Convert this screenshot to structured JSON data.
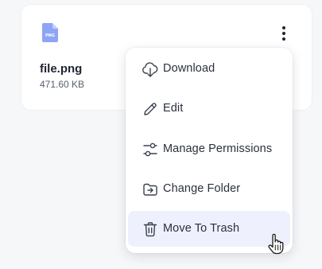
{
  "file": {
    "type_badge": "PNG",
    "name": "file.png",
    "size": "471.60 KB"
  },
  "menu": {
    "items": [
      {
        "label": "Download",
        "icon": "cloud-download-icon"
      },
      {
        "label": "Edit",
        "icon": "pencil-icon"
      },
      {
        "label": "Manage Permissions",
        "icon": "sliders-icon"
      },
      {
        "label": "Change Folder",
        "icon": "folder-move-icon"
      },
      {
        "label": "Move To Trash",
        "icon": "trash-icon"
      }
    ],
    "hovered_item": "Move To Trash"
  },
  "colors": {
    "file_icon": "#8ea4f5",
    "hover_bg": "#eef1fd",
    "text": "#2a303c"
  }
}
